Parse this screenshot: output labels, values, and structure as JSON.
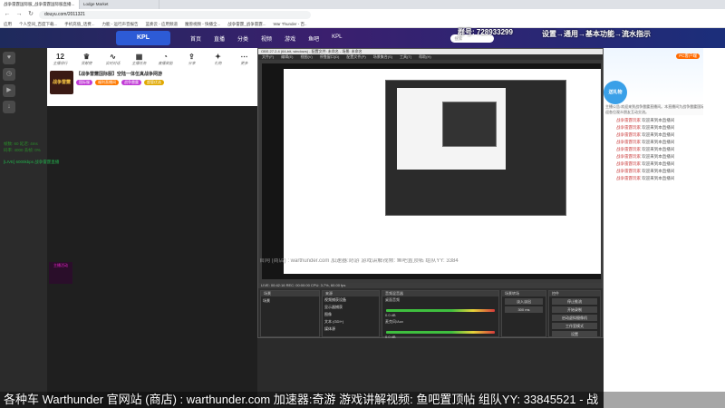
{
  "browser": {
    "tabs": [
      {
        "label": "战争雷霆国际服_战争雷霆国际服直播..."
      },
      {
        "label": "Lodge Market"
      }
    ],
    "url": "douyu.com/2011321",
    "bookmarks": [
      "应用",
      "个人空间_百度下载...",
      "手机充值_话费...",
      "力能 - 运行声音报告",
      "蓝奏云 - 应用频道",
      "魔兽视频 - 快播全...",
      "战争雷霆_战争雷霆...",
      "War Thunder - 百.."
    ]
  },
  "site": {
    "logo": "KPL",
    "nav": [
      "首页",
      "直播",
      "分类",
      "视频",
      "游戏",
      "鱼吧",
      "KPL"
    ],
    "search_placeholder": "搜索"
  },
  "streamer": {
    "stats": [
      {
        "value": "12",
        "label": "主播排行"
      },
      {
        "label": "贡献榜"
      },
      {
        "label": "实时对话"
      },
      {
        "label": "主播任务"
      },
      {
        "label": "直播奖励"
      },
      {
        "label": "分享"
      },
      {
        "label": "礼物"
      },
      {
        "label": "更多"
      }
    ],
    "room_title": "【战争雷霆国际服】空陆一体伍真战争网游",
    "tags": [
      "国际服",
      "福利直播间",
      "战争雷霆",
      "超管优选"
    ],
    "avatar_text": "战争雷霆"
  },
  "overlays": {
    "top_text": "群号: 728933299",
    "top_right": "设置→通用→基本功能→流水指示",
    "obs_overlay": "官网 (商店) : warthunder.com  加速器:奇游  游戏讲解视频: 鱼吧置顶帖  组队YY: 3384",
    "ticker": "各种车 Warthunder  官网站 (商店) : warthunder.com  加速器:奇游  游戏讲解视频: 鱼吧置顶帖  组队YY: 33845521 - 战",
    "stats_line1": "帧数: 60  延迟: 4ms",
    "stats_line2": "码率: 4000  丢帧: 0%",
    "green_line": "[LIVE] 6000kbps  战争雷霆直播",
    "anchor_card": "主播活动"
  },
  "obs": {
    "title": "OBS 27.2.4 (64-bit, windows) - 配置文件: 未命名 - 场景: 未命名",
    "menu": [
      "文件(F)",
      "编辑(E)",
      "视图(V)",
      "停靠窗口(D)",
      "配置文件(P)",
      "场景集合(S)",
      "工具(T)",
      "帮助(H)"
    ],
    "docks": {
      "scenes": "场景",
      "sources": "来源",
      "mixer": "音频混音器",
      "transitions": "场景转场",
      "controls": "控件"
    },
    "scene_item": "场景",
    "sources": [
      "视频捕获设备",
      "显示器捕获",
      "图像",
      "文本 (GDI+)",
      "媒体源"
    ],
    "mixer_channels": [
      {
        "name": "桌面音频",
        "db": "0.0 dB"
      },
      {
        "name": "麦克风/Aux",
        "db": "0.0 dB"
      }
    ],
    "transition": "淡入淡出",
    "duration": "300 ms",
    "controls": [
      "停止推流",
      "开始录制",
      "启动虚拟摄像机",
      "工作室模式",
      "设置",
      "退出"
    ],
    "status": "LIVE: 00:42:16  REC: 00:00:00  CPU: 3.7%, 60.00 fps"
  },
  "chat": {
    "announcement": "主播公告:欢迎来到战争雷霆直播间。本直播间为战争雷霆国际服直播,欢迎各位观众朋友互动交流。",
    "messages": [
      {
        "user": "战争雷霆玩家",
        "text": "欢迎来到本直播间"
      },
      {
        "user": "战争雷霆玩家",
        "text": "欢迎来到本直播间"
      },
      {
        "user": "战争雷霆玩家",
        "text": "欢迎来到本直播间"
      },
      {
        "user": "战争雷霆玩家",
        "text": "欢迎来到本直播间"
      },
      {
        "user": "战争雷霆玩家",
        "text": "欢迎来到本直播间"
      },
      {
        "user": "战争雷霆玩家",
        "text": "欢迎来到本直播间"
      },
      {
        "user": "战争雷霆玩家",
        "text": "欢迎来到本直播间"
      },
      {
        "user": "战争雷霆玩家",
        "text": "欢迎来到本直播间"
      },
      {
        "user": "战争雷霆玩家",
        "text": "欢迎来到本直播间"
      }
    ],
    "gift_label": "送礼物",
    "top_button": "PC客户端"
  }
}
